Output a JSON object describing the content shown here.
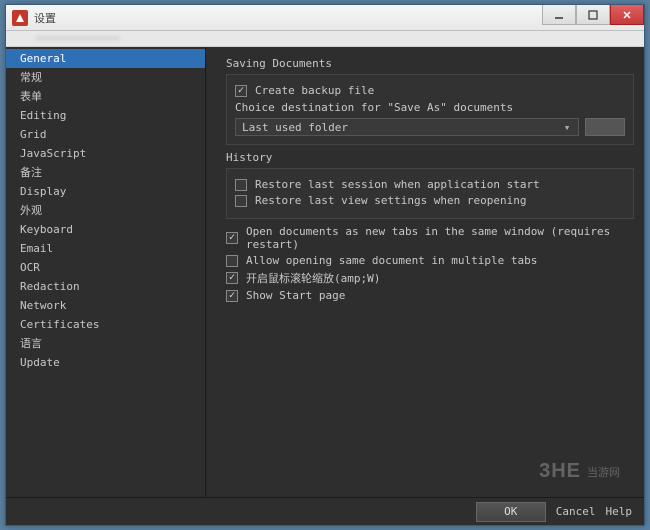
{
  "window": {
    "title": "设置"
  },
  "sidebar": {
    "items": [
      {
        "label": "General",
        "active": true
      },
      {
        "label": "常规"
      },
      {
        "label": "表单"
      },
      {
        "label": "Editing"
      },
      {
        "label": "Grid"
      },
      {
        "label": "JavaScript"
      },
      {
        "label": "备注"
      },
      {
        "label": "Display"
      },
      {
        "label": "外观"
      },
      {
        "label": "Keyboard"
      },
      {
        "label": "Email"
      },
      {
        "label": "OCR"
      },
      {
        "label": "Redaction"
      },
      {
        "label": "Network"
      },
      {
        "label": "Certificates"
      },
      {
        "label": "语言"
      },
      {
        "label": "Update"
      }
    ]
  },
  "content": {
    "saving": {
      "title": "Saving Documents",
      "backup": {
        "checked": true,
        "label": "Create backup file"
      },
      "choice_label": "Choice destination for \"Save As\" documents",
      "select_value": "Last used folder"
    },
    "history": {
      "title": "History",
      "restore_session": {
        "checked": false,
        "label": "Restore last session when application start"
      },
      "restore_view": {
        "checked": false,
        "label": "Restore last view settings when reopening"
      }
    },
    "options": [
      {
        "checked": true,
        "label": "Open documents as new tabs in the same window (requires restart)"
      },
      {
        "checked": false,
        "label": "Allow opening same document in multiple tabs"
      },
      {
        "checked": true,
        "label": "开启鼠标滚轮缩放(amp;W)"
      },
      {
        "checked": true,
        "label": "Show Start page"
      }
    ]
  },
  "footer": {
    "ok": "OK",
    "cancel": "Cancel",
    "help": "Help"
  },
  "watermark": {
    "logo": "3HE",
    "text": "当游网"
  }
}
